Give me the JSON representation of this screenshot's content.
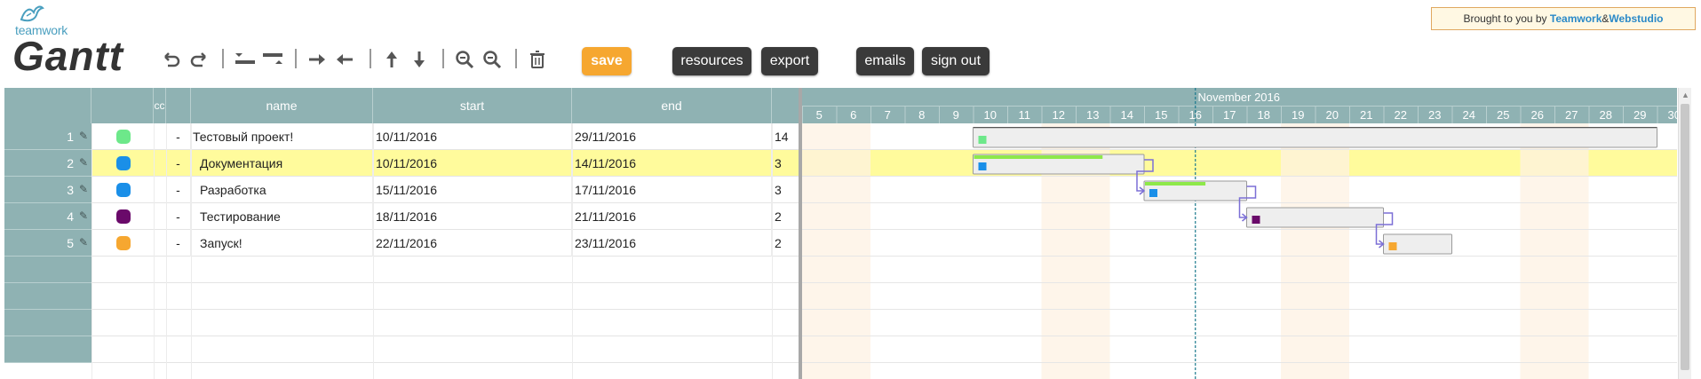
{
  "header": {
    "logo_text": "teamwork",
    "app_title": "Gantt",
    "brought_prefix": "Brought to you by ",
    "brought_link1": "Teamwork",
    "brought_amp": " & ",
    "brought_link2": "Webstudio"
  },
  "toolbar": {
    "icons": [
      "undo-icon",
      "redo-icon",
      "insert-above-icon",
      "insert-below-icon",
      "indent-icon",
      "outdent-icon",
      "move-up-icon",
      "move-down-icon",
      "zoom-in-icon",
      "zoom-out-icon",
      "delete-icon"
    ],
    "save_label": "save",
    "resources_label": "resources",
    "export_label": "export",
    "emails_label": "emails",
    "signout_label": "sign out"
  },
  "grid": {
    "columns": {
      "code": "cc",
      "name": "name",
      "start": "start",
      "end": "end"
    },
    "rows": [
      {
        "num": "1",
        "color": "#6de88a",
        "code": "-",
        "name": "Тестовый проект!",
        "start": "10/11/2016",
        "end": "29/11/2016",
        "dur": "14",
        "indent": 0
      },
      {
        "num": "2",
        "color": "#1a8fe8",
        "code": "-",
        "name": "Документация",
        "start": "10/11/2016",
        "end": "14/11/2016",
        "dur": "3",
        "indent": 1
      },
      {
        "num": "3",
        "color": "#1a8fe8",
        "code": "-",
        "name": "Разработка",
        "start": "15/11/2016",
        "end": "17/11/2016",
        "dur": "3",
        "indent": 1
      },
      {
        "num": "4",
        "color": "#6a0a6a",
        "code": "-",
        "name": "Тестирование",
        "start": "18/11/2016",
        "end": "21/11/2016",
        "dur": "2",
        "indent": 1
      },
      {
        "num": "5",
        "color": "#f6a730",
        "code": "-",
        "name": "Запуск!",
        "start": "22/11/2016",
        "end": "23/11/2016",
        "dur": "2",
        "indent": 1
      }
    ],
    "empty_rows": 4,
    "selected_row": 1
  },
  "gantt": {
    "month_label": "November 2016",
    "days": [
      5,
      6,
      7,
      8,
      9,
      10,
      11,
      12,
      13,
      14,
      15,
      16,
      17,
      18,
      19,
      20,
      21,
      22,
      23,
      24,
      25,
      26,
      27,
      28,
      29,
      30
    ],
    "weekend_days": [
      5,
      6,
      12,
      13,
      19,
      20,
      26,
      27
    ],
    "today": 16.5,
    "bars": [
      {
        "start": 10,
        "end": 30,
        "color": "#6de88a",
        "progress": 0,
        "parent": true
      },
      {
        "start": 10,
        "end": 15,
        "color": "#1a8fe8",
        "progress": 0.76
      },
      {
        "start": 15,
        "end": 18,
        "color": "#1a8fe8",
        "progress": 0.6
      },
      {
        "start": 18,
        "end": 22,
        "color": "#6a0a6a",
        "progress": 0
      },
      {
        "start": 22,
        "end": 24,
        "color": "#f6a730",
        "progress": 0
      }
    ],
    "links": [
      [
        1,
        2
      ],
      [
        2,
        3
      ],
      [
        3,
        4
      ]
    ]
  },
  "colors": {
    "header_bg": "#8fb2b3",
    "selected_row": "#fffb9c",
    "weekend": "#fdf2e3",
    "progress": "#8ee84a",
    "link": "#7b6fd6",
    "today_line": "#1c7a8e"
  }
}
